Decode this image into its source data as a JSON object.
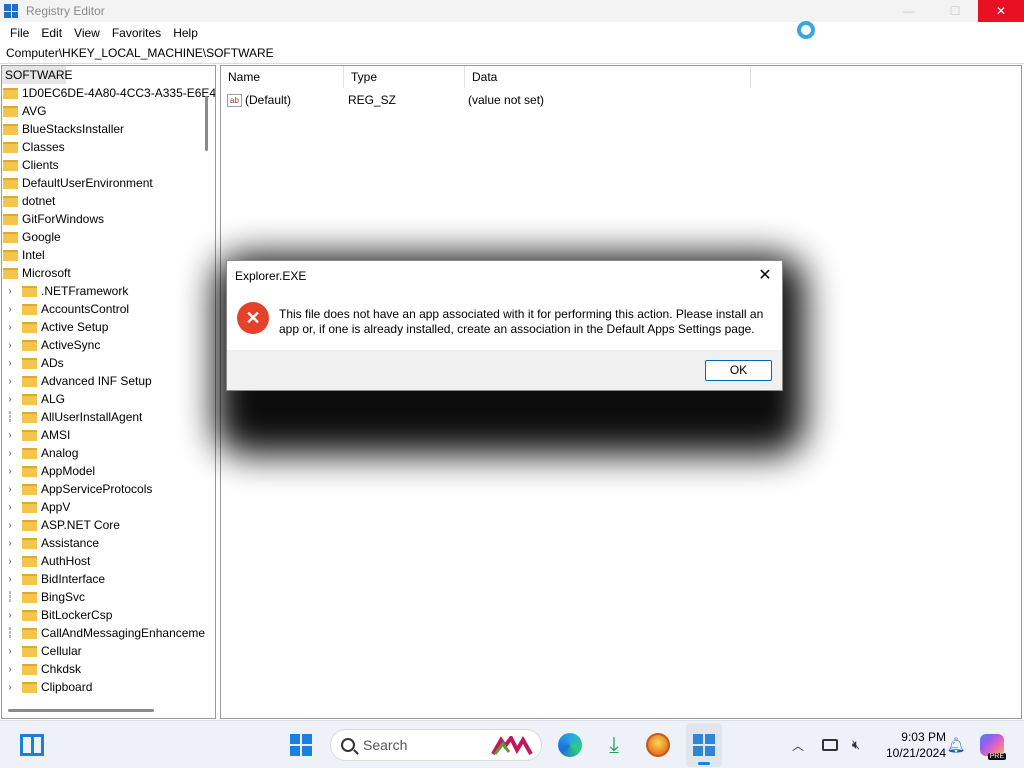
{
  "window": {
    "title": "Registry Editor",
    "controls": {
      "minimize": "—",
      "maximize": "☐",
      "close": "✕"
    }
  },
  "menu": [
    "File",
    "Edit",
    "View",
    "Favorites",
    "Help"
  ],
  "address": "Computer\\HKEY_LOCAL_MACHINE\\SOFTWARE",
  "tree": {
    "root": "SOFTWARE",
    "items": [
      {
        "label": "1D0EC6DE-4A80-4CC3-A335-E6E4",
        "level": 0,
        "expandable": false
      },
      {
        "label": "AVG",
        "level": 0,
        "expandable": false
      },
      {
        "label": "BlueStacksInstaller",
        "level": 0,
        "expandable": false
      },
      {
        "label": "Classes",
        "level": 0,
        "expandable": false
      },
      {
        "label": "Clients",
        "level": 0,
        "expandable": false
      },
      {
        "label": "DefaultUserEnvironment",
        "level": 0,
        "expandable": false
      },
      {
        "label": "dotnet",
        "level": 0,
        "expandable": false
      },
      {
        "label": "GitForWindows",
        "level": 0,
        "expandable": false
      },
      {
        "label": "Google",
        "level": 0,
        "expandable": false
      },
      {
        "label": "Intel",
        "level": 0,
        "expandable": false
      },
      {
        "label": "Microsoft",
        "level": 0,
        "expandable": false
      },
      {
        "label": ".NETFramework",
        "level": 1,
        "expandable": true
      },
      {
        "label": "AccountsControl",
        "level": 1,
        "expandable": true
      },
      {
        "label": "Active Setup",
        "level": 1,
        "expandable": true
      },
      {
        "label": "ActiveSync",
        "level": 1,
        "expandable": true
      },
      {
        "label": "ADs",
        "level": 1,
        "expandable": true
      },
      {
        "label": "Advanced INF Setup",
        "level": 1,
        "expandable": true
      },
      {
        "label": "ALG",
        "level": 1,
        "expandable": true
      },
      {
        "label": "AllUserInstallAgent",
        "level": 1,
        "expandable": false
      },
      {
        "label": "AMSI",
        "level": 1,
        "expandable": true
      },
      {
        "label": "Analog",
        "level": 1,
        "expandable": true
      },
      {
        "label": "AppModel",
        "level": 1,
        "expandable": true
      },
      {
        "label": "AppServiceProtocols",
        "level": 1,
        "expandable": true
      },
      {
        "label": "AppV",
        "level": 1,
        "expandable": true
      },
      {
        "label": "ASP.NET Core",
        "level": 1,
        "expandable": true
      },
      {
        "label": "Assistance",
        "level": 1,
        "expandable": true
      },
      {
        "label": "AuthHost",
        "level": 1,
        "expandable": true
      },
      {
        "label": "BidInterface",
        "level": 1,
        "expandable": true
      },
      {
        "label": "BingSvc",
        "level": 1,
        "expandable": false
      },
      {
        "label": "BitLockerCsp",
        "level": 1,
        "expandable": true
      },
      {
        "label": "CallAndMessagingEnhanceme",
        "level": 1,
        "expandable": false
      },
      {
        "label": "Cellular",
        "level": 1,
        "expandable": true
      },
      {
        "label": "Chkdsk",
        "level": 1,
        "expandable": true
      },
      {
        "label": "Clipboard",
        "level": 1,
        "expandable": true
      }
    ]
  },
  "values": {
    "columns": [
      "Name",
      "Type",
      "Data"
    ],
    "rows": [
      {
        "name": "(Default)",
        "type": "REG_SZ",
        "data": "(value not set)",
        "icon": "ab"
      }
    ]
  },
  "dialog": {
    "title": "Explorer.EXE",
    "close": "✕",
    "icon": "error-icon",
    "icon_glyph": "✕",
    "message": "This file does not have an app associated with it for performing this action. Please install an app or, if one is already installed, create an association in the Default Apps Settings page.",
    "ok_label": "OK"
  },
  "taskbar": {
    "search_label": "Search",
    "time": "9:03 PM",
    "date": "10/21/2024",
    "chevron": "︿",
    "download_glyph": "⤓",
    "sound_glyph": "🔇︎",
    "bell_glyph": "🔔︎",
    "pre_badge": "PRE"
  },
  "colors": {
    "accent": "#0067c0",
    "close_button": "#e81123",
    "error_red": "#e5412b",
    "folder": "#f4c44d"
  }
}
